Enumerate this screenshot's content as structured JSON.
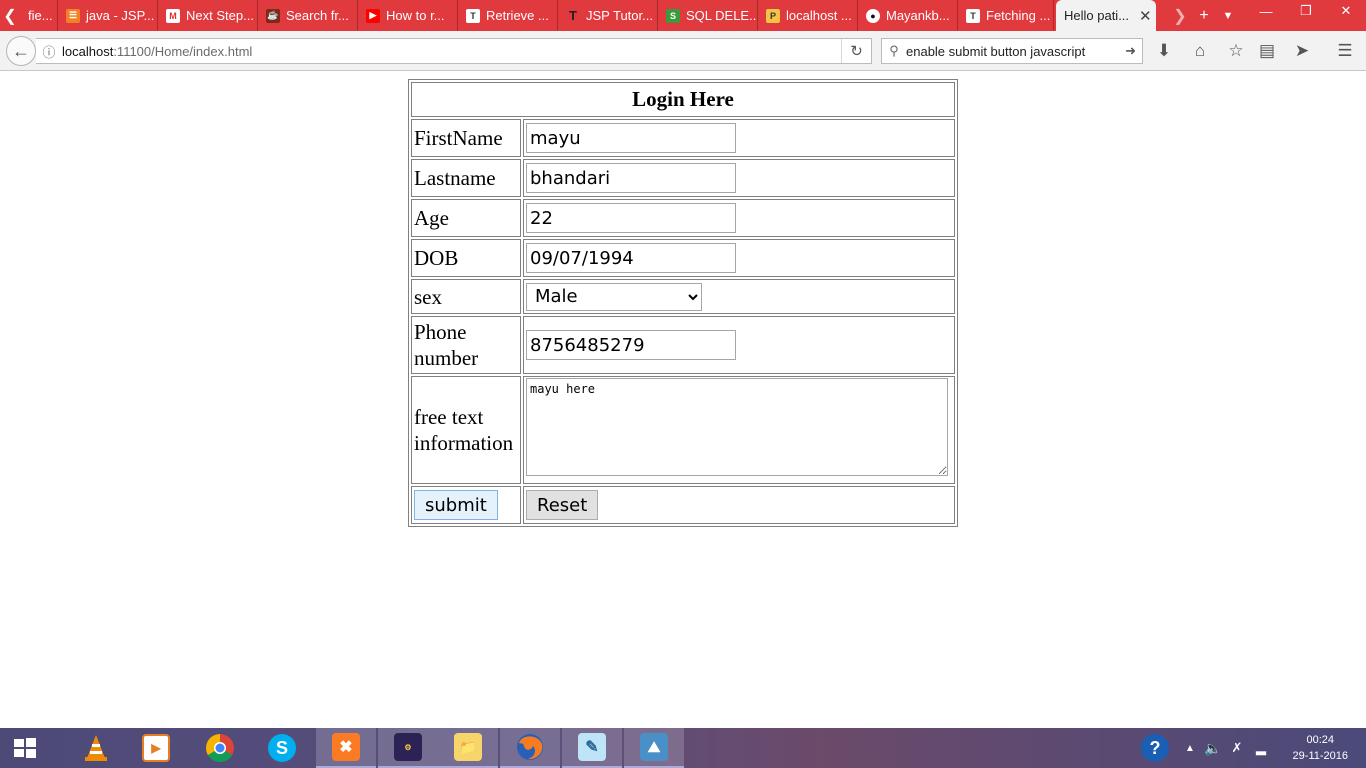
{
  "browser": {
    "tabs": [
      {
        "label": "fie...",
        "icon": "page-icon"
      },
      {
        "label": "java - JSP...",
        "icon": "stackoverflow-icon"
      },
      {
        "label": "Next Step...",
        "icon": "gmail-icon"
      },
      {
        "label": "Search fr...",
        "icon": "java-icon"
      },
      {
        "label": "How to r...",
        "icon": "youtube-icon"
      },
      {
        "label": "Retrieve ...",
        "icon": "tutorial-icon"
      },
      {
        "label": "JSP Tutor...",
        "icon": "t-icon"
      },
      {
        "label": "SQL DELE...",
        "icon": "sql-icon"
      },
      {
        "label": "localhost ...",
        "icon": "phpmyadmin-icon"
      },
      {
        "label": "Mayankb...",
        "icon": "github-icon"
      },
      {
        "label": "Fetching ...",
        "icon": "tutorial-icon"
      }
    ],
    "active_tab": {
      "label": "Hello pati..."
    },
    "url": {
      "host": "localhost",
      "path": ":11100/Home/index.html"
    },
    "search": {
      "value": "enable submit button javascript"
    },
    "colors": {
      "tabbar": "#e0393e",
      "navbar": "#f2f2f2"
    }
  },
  "form": {
    "title": "Login Here",
    "fields": {
      "firstname": {
        "label": "FirstName",
        "value": "mayu"
      },
      "lastname": {
        "label": "Lastname",
        "value": "bhandari"
      },
      "age": {
        "label": "Age",
        "value": "22"
      },
      "dob": {
        "label": "DOB",
        "value": "09/07/1994"
      },
      "sex": {
        "label": "sex",
        "selected": "Male"
      },
      "phone": {
        "label": "Phone number",
        "value": "8756485279"
      },
      "info": {
        "label": "free text information",
        "value": "mayu here"
      }
    },
    "submit_label": "submit",
    "reset_label": "Reset"
  },
  "taskbar": {
    "apps": [
      "start-icon",
      "vlc-icon",
      "media-player-icon",
      "chrome-icon",
      "skype-icon",
      "xampp-icon",
      "java-ee-ide-icon",
      "file-explorer-icon",
      "firefox-icon",
      "notepad-icon",
      "photos-icon"
    ],
    "time": "00:24",
    "date": "29-11-2016"
  }
}
